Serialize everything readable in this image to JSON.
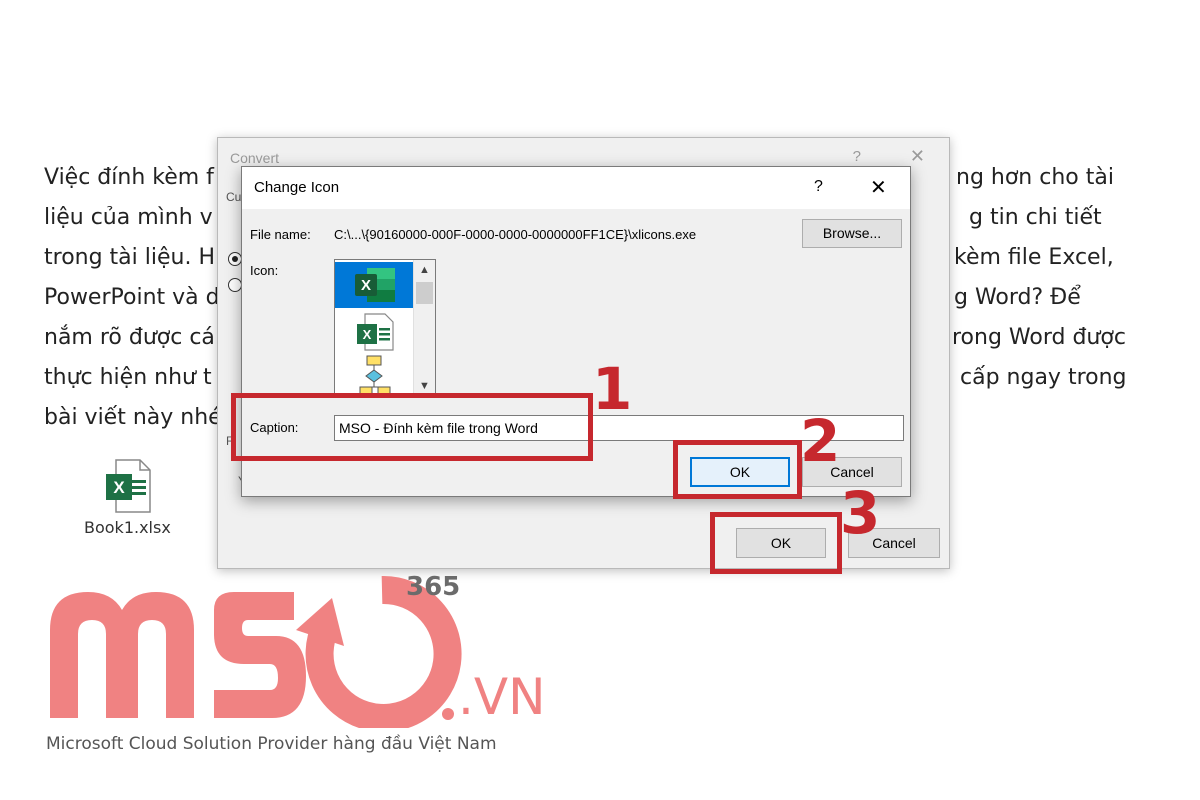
{
  "article": {
    "line1_left": "Việc đính kèm f",
    "line1_right": "ng hơn cho tài",
    "line2_left": "liệu của mình v",
    "line2_right": "g tin chi tiết",
    "line3_left": "trong tài liệu. H",
    "line3_right": "kèm file Excel,",
    "line4_left": "PowerPoint và d",
    "line4_right": "g Word? Để",
    "line5_left": "nắm rõ được cá",
    "line5_right": "rong Word được",
    "line6_left": "thực hiện như t",
    "line6_right": "cấp ngay trong",
    "line7_left": "bài viết này nhé"
  },
  "embedded_file": {
    "caption": "Book1.xlsx"
  },
  "convert_dialog": {
    "title": "Convert",
    "help": "?",
    "close": "✕",
    "stub_cu": "Cu",
    "stub_p": "F",
    "stub_y": "Y",
    "ok_label": "OK",
    "cancel_label": "Cancel"
  },
  "change_icon_dialog": {
    "title": "Change Icon",
    "help": "?",
    "close": "✕",
    "file_name_label": "File name:",
    "file_name_value": "C:\\...\\{90160000-000F-0000-0000-0000000FF1CE}\\xlicons.exe",
    "browse_label": "Browse...",
    "icon_label": "Icon:",
    "caption_label": "Caption:",
    "caption_value": "MSO - Đính kèm file trong Word",
    "ok_label": "OK",
    "cancel_label": "Cancel",
    "icons": [
      "excel-icon",
      "excel-document-icon",
      "diagram-icon"
    ]
  },
  "annotations": {
    "step1": "1",
    "step2": "2",
    "step3": "3"
  },
  "logo": {
    "brand": "MSO",
    "suffix": ".VN",
    "badge": "365",
    "tagline": "Microsoft Cloud Solution Provider hàng đầu Việt Nam",
    "color": "#f08282"
  },
  "colors": {
    "annotation_red": "#c6282e",
    "selection_blue": "#0078d7",
    "excel_green": "#1e7145"
  }
}
